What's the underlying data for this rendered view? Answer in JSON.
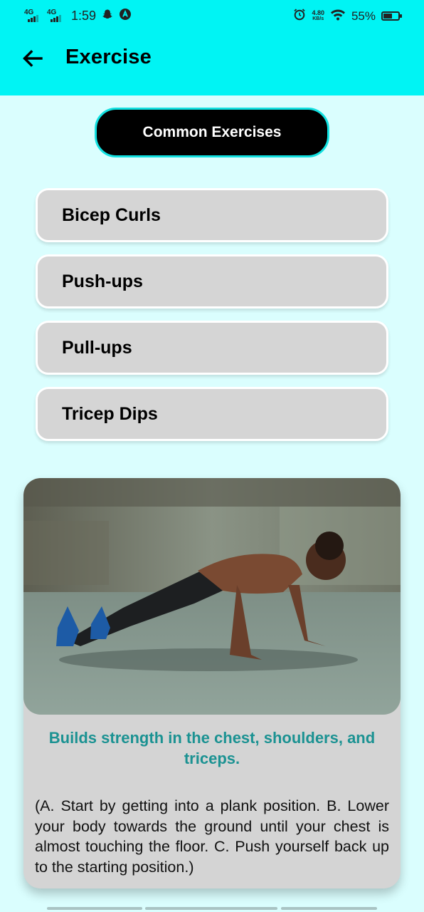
{
  "status_bar": {
    "network_1": "4G",
    "network_2": "4G",
    "time": "1:59",
    "speed_value": "4.80",
    "speed_unit": "KB/s",
    "battery": "55%",
    "battery_level": 0.55
  },
  "app_bar": {
    "title": "Exercise",
    "back_icon": "arrow-left-icon",
    "color": "#00f4f4"
  },
  "section_button": {
    "label": "Common Exercises"
  },
  "exercises": [
    {
      "label": "Bicep Curls"
    },
    {
      "label": "Push-ups"
    },
    {
      "label": "Pull-ups"
    },
    {
      "label": "Tricep Dips"
    }
  ],
  "detail_card": {
    "image_alt_icon": "push-up-photo",
    "heading": "Builds strength in the chest, shoulders, and triceps.",
    "description": "(A. Start by getting into a plank position. B. Lower your body towards the ground until your chest is almost touching the floor. C. Push yourself back up to the starting position.)",
    "heading_color": "#1b9292"
  },
  "colors": {
    "background": "#dafefe",
    "accent": "#00f4f4",
    "list_item": "#d5d5d5"
  }
}
